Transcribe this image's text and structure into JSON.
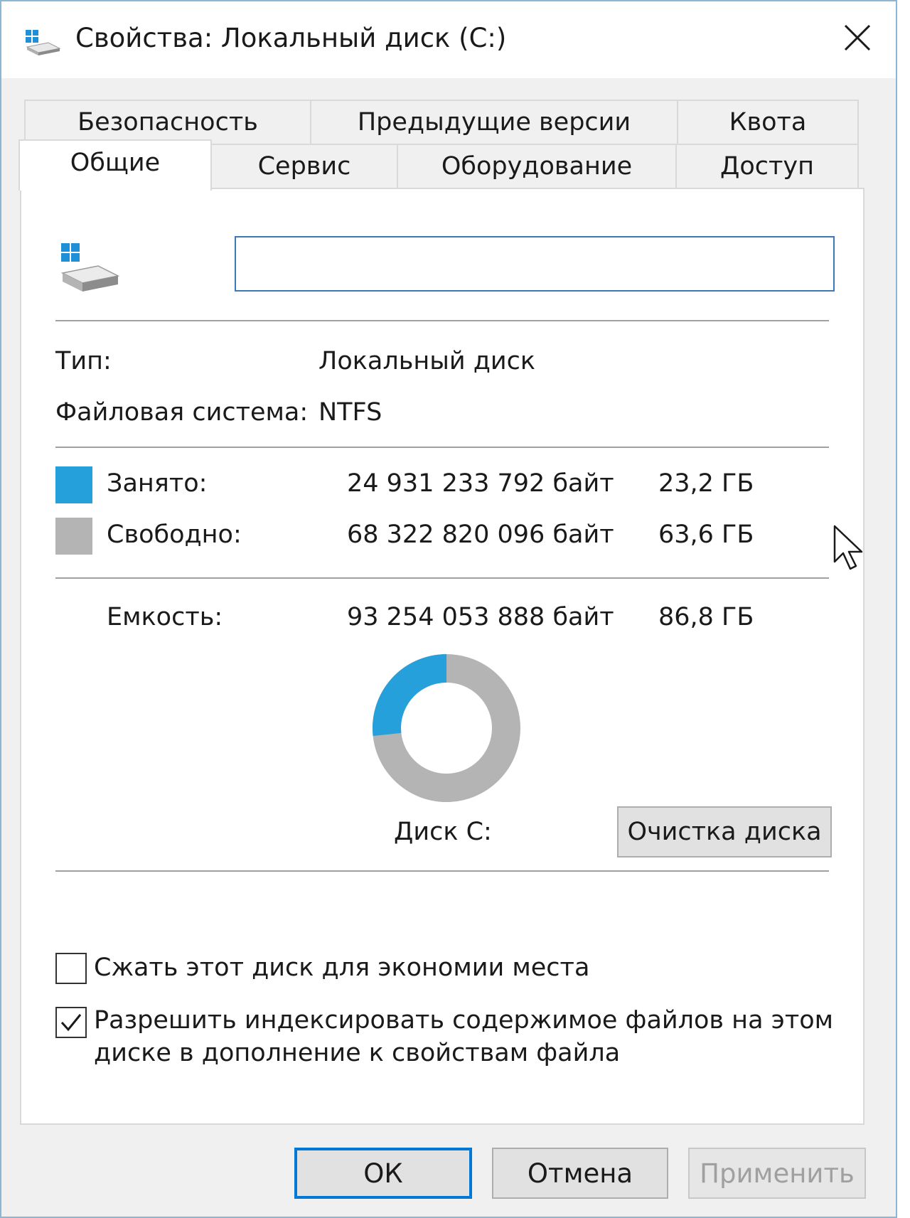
{
  "window": {
    "title": "Свойства: Локальный диск (C:)",
    "icon": "drive-icon",
    "close_icon": "close-icon"
  },
  "tabs": {
    "row1": [
      {
        "label": "Безопасность"
      },
      {
        "label": "Предыдущие версии"
      },
      {
        "label": "Квота"
      }
    ],
    "row2": [
      {
        "label": "Общие",
        "active": true
      },
      {
        "label": "Сервис"
      },
      {
        "label": "Оборудование"
      },
      {
        "label": "Доступ"
      }
    ]
  },
  "general": {
    "volume_label_value": "",
    "type_label": "Тип:",
    "type_value": "Локальный диск",
    "fs_label": "Файловая система:",
    "fs_value": "NTFS",
    "used": {
      "label": "Занято:",
      "bytes": "24 931 233 792 байт",
      "size": "23,2 ГБ",
      "color": "#26a0da"
    },
    "free": {
      "label": "Свободно:",
      "bytes": "68 322 820 096 байт",
      "size": "63,6 ГБ",
      "color": "#b4b4b4"
    },
    "capacity": {
      "label": "Емкость:",
      "bytes": "93 254 053 888 байт",
      "size": "86,8 ГБ"
    },
    "used_fraction": 0.267,
    "disk_label": "Диск C:",
    "cleanup_button": "Очистка диска",
    "compress": {
      "label": "Сжать этот диск для экономии места",
      "checked": false
    },
    "index": {
      "line1": "Разрешить индексировать содержимое файлов на этом",
      "line2": "диске в дополнение к свойствам файла",
      "checked": true
    }
  },
  "buttons": {
    "ok": "ОК",
    "cancel": "Отмена",
    "apply": "Применить"
  },
  "colors": {
    "accent": "#0078d7",
    "used": "#26a0da",
    "free": "#b4b4b4"
  }
}
